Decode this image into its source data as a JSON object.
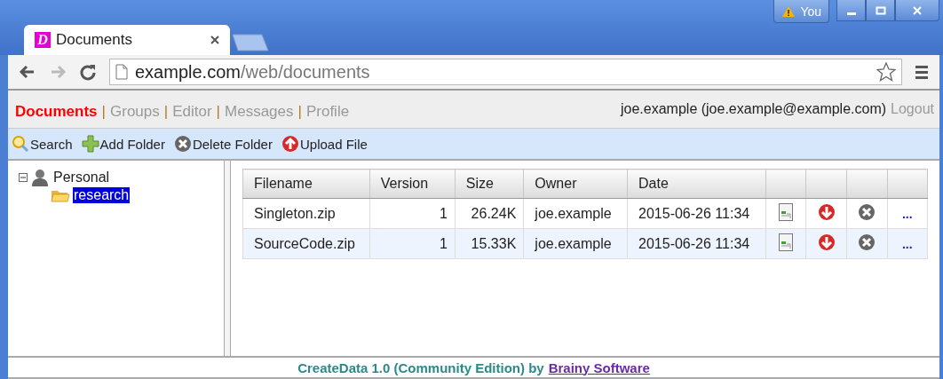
{
  "browser": {
    "profile": "You",
    "tabs": [
      {
        "title": "Documents",
        "favicon": "D",
        "selected": true
      }
    ],
    "address": {
      "host": "example.com",
      "path": "/web/documents"
    }
  },
  "nav": {
    "items": [
      {
        "kind": "link",
        "label": "Documents",
        "selected": true
      },
      {
        "kind": "separator",
        "label": "|"
      },
      {
        "kind": "link",
        "label": "Groups",
        "selected": false
      },
      {
        "kind": "separator",
        "label": "|"
      },
      {
        "kind": "link",
        "label": "Editor",
        "selected": false
      },
      {
        "kind": "separator",
        "label": "|"
      },
      {
        "kind": "link",
        "label": "Messages",
        "selected": false
      },
      {
        "kind": "separator",
        "label": "|"
      },
      {
        "kind": "link",
        "label": "Profile",
        "selected": false
      }
    ],
    "user": "joe.example (joe.example@example.com)",
    "logout": "Logout"
  },
  "toolbar": [
    {
      "kind": "search",
      "label": "Search"
    },
    {
      "kind": "add",
      "label": "Add Folder"
    },
    {
      "kind": "delete",
      "label": "Delete Folder"
    },
    {
      "kind": "upload",
      "label": "Upload File"
    }
  ],
  "tree": [
    {
      "label": "Personal",
      "expanded": true,
      "selected": false,
      "children": [
        {
          "label": "research",
          "selected": true
        }
      ]
    }
  ],
  "table": {
    "columns": [
      "Filename",
      "Version",
      "Size",
      "Owner",
      "Date"
    ],
    "rows": [
      {
        "filename": "Singleton.zip",
        "version": "1",
        "size": "26.24K",
        "owner": "joe.example",
        "date": "2015-06-26 11:34",
        "more": "..."
      },
      {
        "filename": "SourceCode.zip",
        "version": "1",
        "size": "15.33K",
        "owner": "joe.example",
        "date": "2015-06-26 11:34",
        "more": "..."
      }
    ]
  },
  "footer": {
    "text": "CreateData 1.0 (Community Edition) by",
    "link": "Brainy Software"
  }
}
